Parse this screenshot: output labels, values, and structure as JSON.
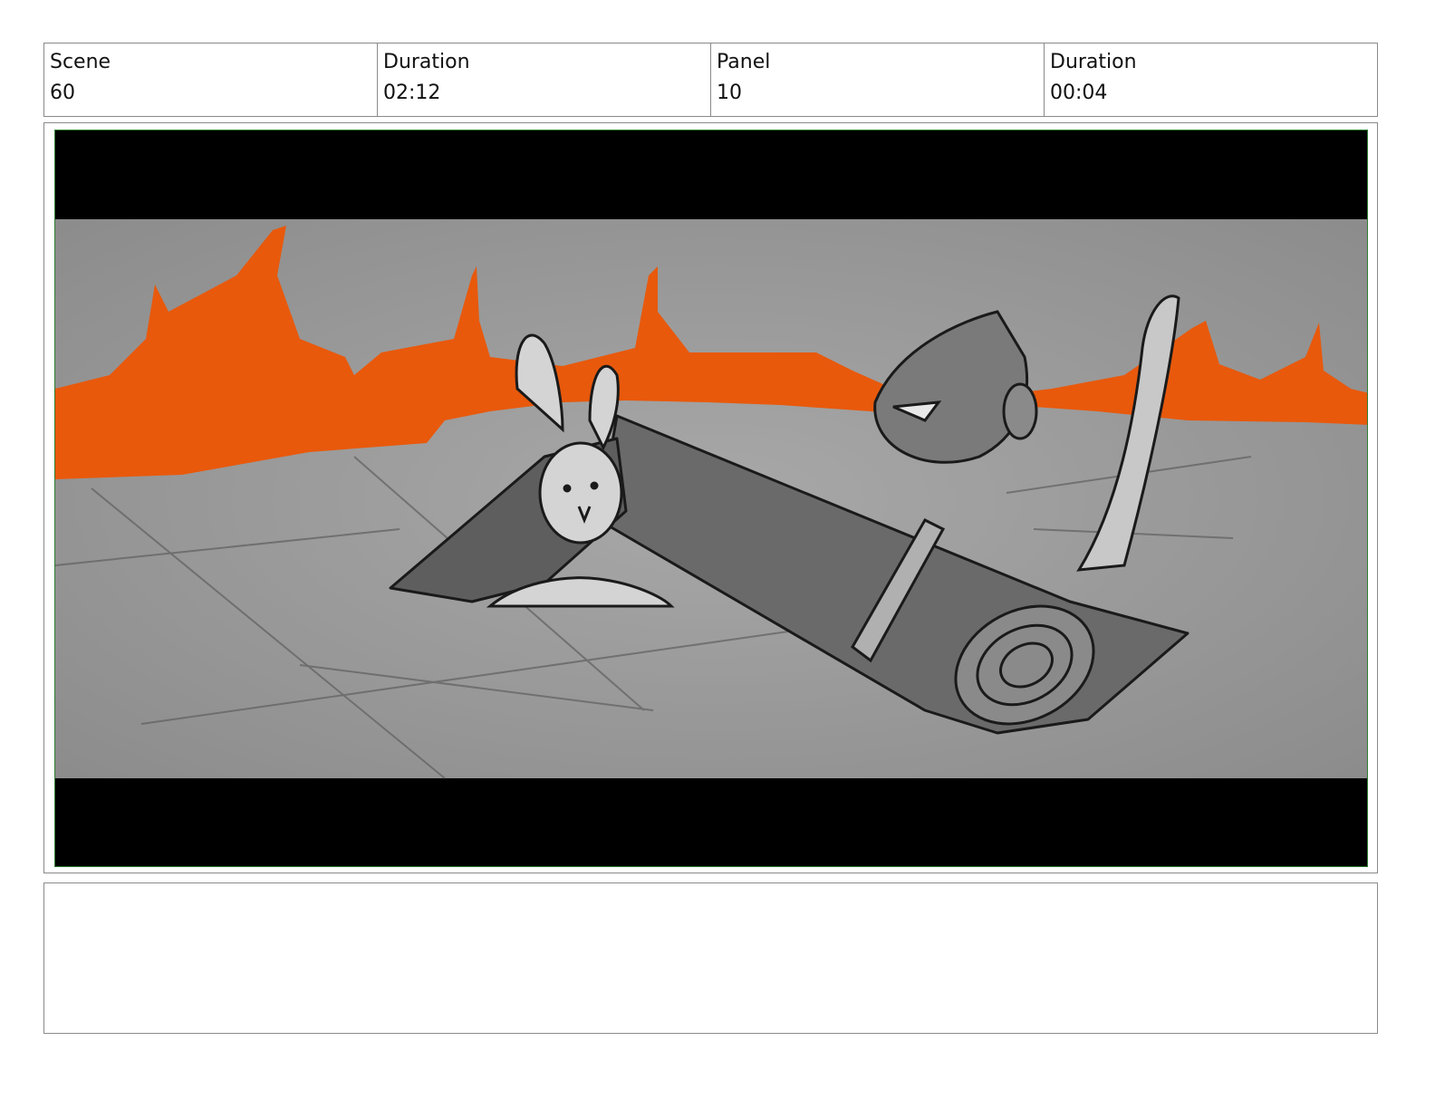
{
  "header": {
    "scene_label": "Scene",
    "scene_value": "60",
    "scene_duration_label": "Duration",
    "scene_duration_value": "02:12",
    "panel_label": "Panel",
    "panel_value": "10",
    "panel_duration_label": "Duration",
    "panel_duration_value": "00:04"
  },
  "panel": {
    "frame_color": "#2e7d32",
    "fire_color": "#e8590c",
    "ground_color": "#9a9a9a"
  },
  "notes": {
    "text": ""
  }
}
